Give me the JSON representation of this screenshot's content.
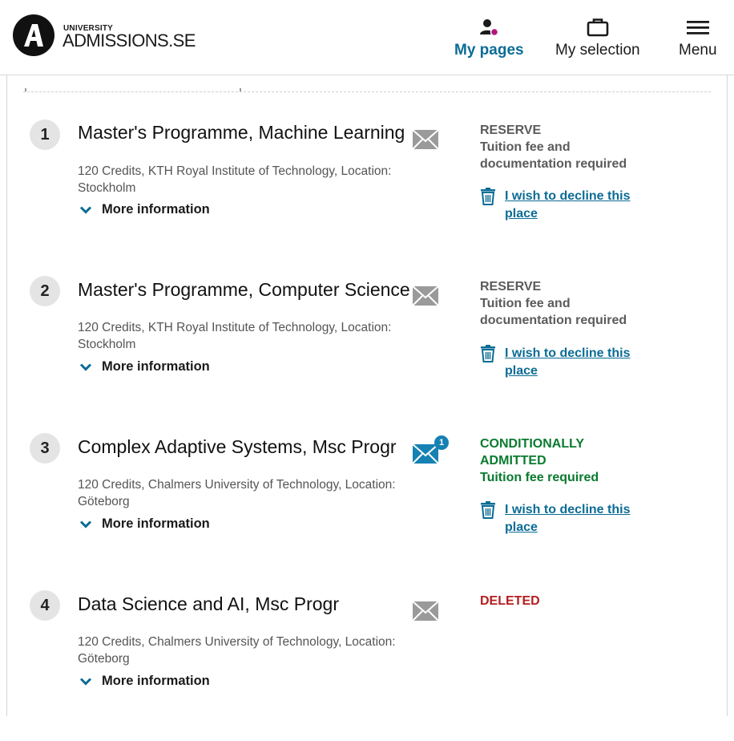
{
  "logo": {
    "small": "UNIVERSITY",
    "big": "ADMISSIONS.SE"
  },
  "nav": {
    "my_pages": "My pages",
    "my_selection": "My selection",
    "menu": "Menu"
  },
  "colors": {
    "link": "#0b6c95",
    "reserve": "#5b5b5b",
    "admitted": "#0a7a2f",
    "deleted": "#b41e1e",
    "notification_dot": "#b0177a"
  },
  "applications": [
    {
      "rank": "1",
      "title": "Master's Programme, Machine Learning",
      "details": "120 Credits, KTH Royal Institute of Technology, Location: Stockholm",
      "more": "More information",
      "status_title": "RESERVE",
      "status_note": "Tuition fee and documentation required",
      "decline": "I wish to decline this place"
    },
    {
      "rank": "2",
      "title": "Master's Programme, Computer Science",
      "details": "120 Credits, KTH Royal Institute of Technology, Location: Stockholm",
      "more": "More information",
      "status_title": "RESERVE",
      "status_note": "Tuition fee and documentation required",
      "decline": "I wish to decline this place"
    },
    {
      "rank": "3",
      "title": "Complex Adaptive Systems, Msc Progr",
      "details": "120 Credits, Chalmers University of Technology, Location: Göteborg",
      "more": "More information",
      "status_title": "CONDITIONALLY ADMITTED",
      "status_note": "Tuition fee required",
      "decline": "I wish to decline this place",
      "message_count": "1"
    },
    {
      "rank": "4",
      "title": "Data Science and AI, Msc Progr",
      "details": "120 Credits, Chalmers University of Technology, Location: Göteborg",
      "more": "More information",
      "status_title": "DELETED"
    }
  ]
}
